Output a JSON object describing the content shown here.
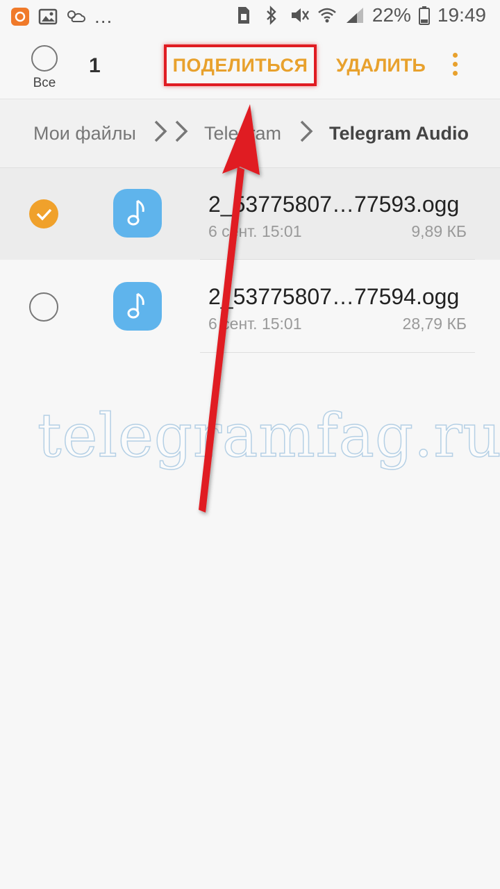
{
  "status_bar": {
    "more_dots": "...",
    "battery_percent": "22%",
    "time": "19:49"
  },
  "action_bar": {
    "select_all_label": "Все",
    "selected_count": "1",
    "share_label": "ПОДЕЛИТЬСЯ",
    "delete_label": "УДАЛИТЬ"
  },
  "breadcrumb": {
    "items": [
      "Мои файлы",
      "Telegram",
      "Telegram Audio"
    ]
  },
  "files": [
    {
      "name": "2_53775807…77593.ogg",
      "date": "6 сент. 15:01",
      "size": "9,89 КБ",
      "selected": true
    },
    {
      "name": "2_53775807…77594.ogg",
      "date": "6 сент. 15:01",
      "size": "28,79 КБ",
      "selected": false
    }
  ],
  "watermark": "telegramfag.ru",
  "colors": {
    "accent": "#e8a12d",
    "highlight_red": "#e01b22",
    "file_icon_blue": "#5fb4ec"
  }
}
